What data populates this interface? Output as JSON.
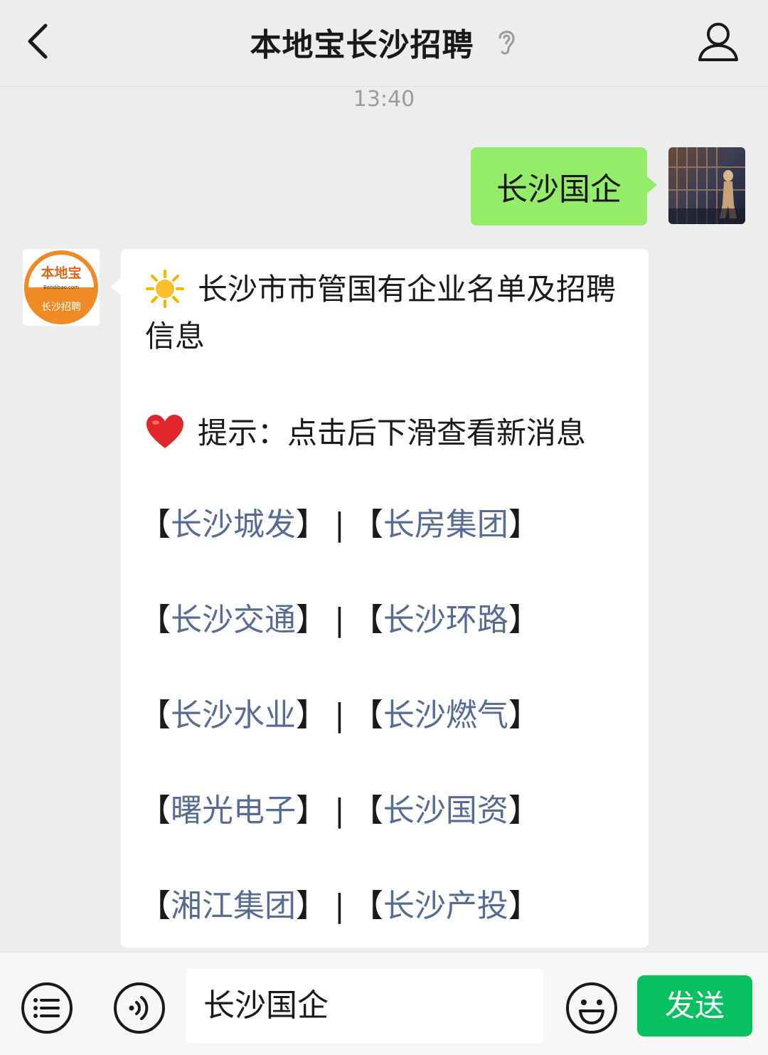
{
  "header": {
    "title": "本地宝长沙招聘",
    "icons": {
      "back": "chevron-left-icon",
      "ear": "ear-icon",
      "profile": "person-icon"
    }
  },
  "chat": {
    "timestamp": "13:40",
    "sent_message": "长沙国企",
    "received": {
      "title_line": "长沙市市管国有企业名单及招聘信息",
      "tip_line": "提示：点击后下滑查看新消息",
      "bracket_open": "【",
      "bracket_close": "】",
      "separator": "|",
      "links": [
        [
          "长沙城发",
          "长房集团"
        ],
        [
          "长沙交通",
          "长沙环路"
        ],
        [
          "长沙水业",
          "长沙燃气"
        ],
        [
          "曙光电子",
          "长沙国资"
        ],
        [
          "湘江集团",
          "长沙产投"
        ]
      ]
    },
    "bot_avatar": {
      "line1": "本地宝",
      "line2": "Bendibao.com",
      "line3": "长沙招聘"
    }
  },
  "input_bar": {
    "input_value": "长沙国企",
    "send_label": "发送",
    "icons": {
      "menu": "list-menu-icon",
      "voice": "voice-icon",
      "emoji": "smiley-icon"
    }
  },
  "colors": {
    "sent_bubble": "#95ec69",
    "link": "#576b95",
    "send_button": "#07c160",
    "avatar_orange": "#f08a24"
  }
}
